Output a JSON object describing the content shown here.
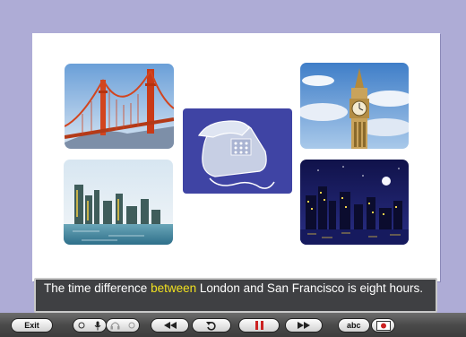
{
  "caption": {
    "before": "The time difference ",
    "highlight": "between",
    "after": " London and San Francisco is eight hours."
  },
  "toolbar": {
    "exit_label": "Exit",
    "abc_label": "abc"
  },
  "images": [
    {
      "name": "golden-gate-bridge"
    },
    {
      "name": "big-ben"
    },
    {
      "name": "telephone"
    },
    {
      "name": "san-francisco-skyline"
    },
    {
      "name": "london-night-skyline"
    }
  ],
  "colors": {
    "background": "#aeacd6",
    "highlight": "#f0e020",
    "caption_bg": "#3f4043",
    "pause_icon": "#cc2222"
  }
}
